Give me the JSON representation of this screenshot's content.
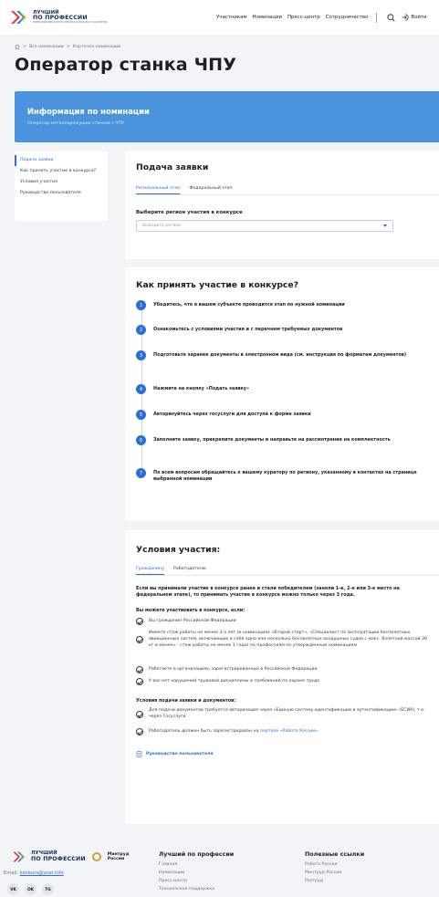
{
  "header": {
    "logo": {
      "line1": "ЛУЧШИЙ",
      "line2": "ПО ПРОФЕССИИ",
      "sub": "ВСЕРОССИЙСКИЙ КОНКУРС ПРОФЕССИОНАЛЬНОГО МАСТЕРСТВА"
    },
    "nav": [
      "Участникам",
      "Номинации",
      "Пресс-центр",
      "Сотрудничество"
    ],
    "login_label": "Войти"
  },
  "breadcrumb": [
    "Все номинации",
    "Карточка номинации"
  ],
  "page_title": "Оператор станка ЧПУ",
  "banner": {
    "title": "Информация по номинации",
    "subtitle": "Оператор металлорежущих станков с ЧПУ"
  },
  "sidebar": {
    "items": [
      {
        "label": "Подача заявки",
        "active": true
      },
      {
        "label": "Как принять участие в конкурсе?",
        "active": false
      },
      {
        "label": "Условия участия",
        "active": false
      },
      {
        "label": "Руководство пользователя",
        "active": false
      }
    ]
  },
  "application": {
    "title": "Подача заявки",
    "tabs": [
      {
        "label": "Региональный этап",
        "active": true
      },
      {
        "label": "Федеральный этап",
        "active": false
      }
    ],
    "region_label": "Выберите регион участия в конкурсе",
    "region_placeholder": "Выберите регион"
  },
  "howto": {
    "title": "Как принять участие в конкурсе?",
    "steps": [
      {
        "num": "1",
        "text": "Убедитесь, что в вашем субъекте проводится этап по нужной номинации"
      },
      {
        "num": "2",
        "text": "Ознакомьтесь с условиями участия и с перечнем требуемых документов"
      },
      {
        "num": "3",
        "text": "Подготовьте заранее документы в электронном виде (см. инструкция по форматам документов)"
      },
      {
        "num": "4",
        "text": "Нажмите на кнопку «Подать заявку»"
      },
      {
        "num": "5",
        "text": "Авторизуйтесь через госуслуги для доступа к форме заявки"
      },
      {
        "num": "6",
        "text": "Заполните заявку, прикрепите документы и направьте на рассмотрение на комплектность"
      },
      {
        "num": "7",
        "text": "По всем вопросам обращайтесь к вашему куратору по региону, указанному в контактах на странице выбранной номинации"
      }
    ]
  },
  "conditions": {
    "title": "Условия участия:",
    "tabs": [
      {
        "label": "Гражданину",
        "active": true
      },
      {
        "label": "Работодателю",
        "active": false
      }
    ],
    "intro": "Если вы принимали участие в конкурсе ранее и стали победителем (заняли 1-е, 2-е или 3-е место на федеральном этапе), то принимать участие в конкурсе можно только через 3 года.",
    "can_title": "Вы можете участвовать в конкурсе, если:",
    "can_items": [
      "Вы гражданин Российской Федерации",
      "Имеете стаж работы не менее 3-х лет (в номинациях «Второй старт», «Специалист по эксплуатации беспилотных авиационных систем, включающих в себя одно или несколько беспилотных воздушных судов с макс. Взлетной массой 30 кг и менее» - стаж работы не менее 1 года) по профессиям по утвержденным номинациям",
      "Работаете в организациях, зарегистрированных в Российской Федерации",
      "У вас нет нарушений трудовой дисциплины и требований по охране труда"
    ],
    "docs_title": "Условия подачи заявки и документов:",
    "doc_item1": "Для подачи документов требуется авторизация через «Единую систему идентификации и аутентификации» (ЕСИА), т.е. через Госуслуги.",
    "doc_item2_prefix": "Работодатель должен быть зарегистрирован на ",
    "doc_item2_link": "портале «Работа России»",
    "doc_item2_suffix": ".",
    "guide_link": "Руководство пользователя"
  },
  "footer": {
    "ministry": "Минтруд России",
    "email_label": "Email: ",
    "email": "konkurs@vcot.info",
    "social": [
      "VK",
      "OK",
      "TG"
    ],
    "col1_title": "Лучший по профессии",
    "col1_links": [
      "Главная",
      "Номинации",
      "Пресс-центр",
      "Техническая поддержка"
    ],
    "col2_title": "Полезные ссылки",
    "col2_links": [
      "Работа России",
      "Минтруд России",
      "Роструд"
    ]
  },
  "colors": {
    "accent": "#2b6fd6",
    "banner": "#4b93dc",
    "background": "#f3f4f6"
  }
}
